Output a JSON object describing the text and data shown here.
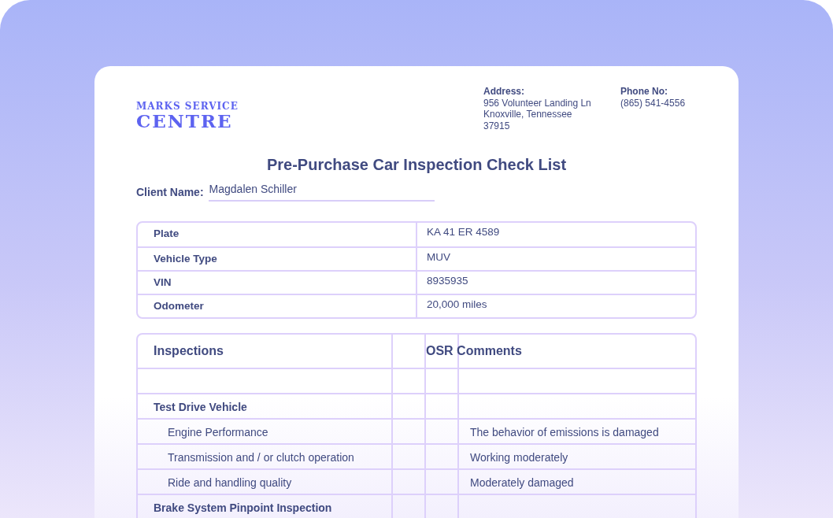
{
  "logo": {
    "line_1": "MARKS SERVICE",
    "line_2": "CENTRE"
  },
  "address": {
    "label": "Address:",
    "lines": [
      "956 Volunteer Landing Ln",
      "Knoxville, Tennessee",
      "37915"
    ]
  },
  "phone": {
    "label": "Phone No:",
    "value": "(865) 541-4556"
  },
  "title": "Pre-Purchase Car Inspection Check List",
  "client": {
    "label": "Client Name:",
    "value": "Magdalen Schiller"
  },
  "vehicle": [
    {
      "label": "Plate",
      "value": "KA 41 ER 4589"
    },
    {
      "label": "Vehicle Type",
      "value": "MUV"
    },
    {
      "label": "VIN",
      "value": "8935935"
    },
    {
      "label": "Odometer",
      "value": "20,000 miles"
    }
  ],
  "inspections": {
    "columns": [
      "Inspections",
      "OSR Comments"
    ],
    "rows": [
      {
        "kind": "blank"
      },
      {
        "kind": "section",
        "name": "Test Drive Vehicle"
      },
      {
        "kind": "item",
        "name": "Engine Performance",
        "comment": "The behavior of emissions is damaged"
      },
      {
        "kind": "item",
        "name": "Transmission and / or clutch operation",
        "comment": "Working moderately"
      },
      {
        "kind": "item",
        "name": "Ride and handling quality",
        "comment": "Moderately damaged"
      },
      {
        "kind": "section",
        "name": "Brake System Pinpoint Inspection"
      }
    ]
  }
}
